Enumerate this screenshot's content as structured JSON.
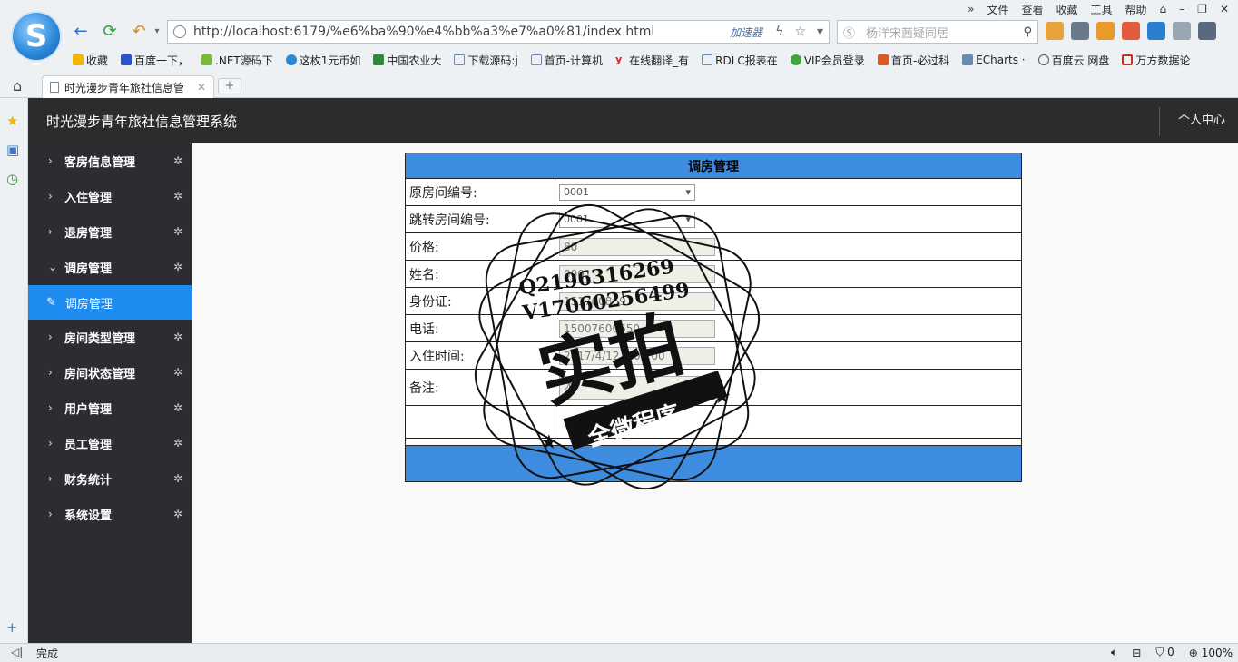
{
  "browser": {
    "menu": [
      "»",
      "文件",
      "查看",
      "收藏",
      "工具",
      "帮助"
    ],
    "url": "http://localhost:6179/%e6%ba%90%e4%bb%a3%e7%a0%81/index.html",
    "accelerator": "加速器",
    "search_placeholder": "杨洋宋茜疑同居",
    "bookmarks": [
      "收藏",
      "百度一下，",
      ".NET源码下",
      "这枚1元币如",
      "中国农业大",
      "下载源码:j",
      "首页-计算机",
      "在线翻译_有",
      "RDLC报表在",
      "VIP会员登录",
      "首页-必过科",
      "ECharts ·",
      "百度云 网盘",
      "万方数据论"
    ],
    "tab_title": "时光漫步青年旅社信息管",
    "status": "完成",
    "zoom": "100%",
    "counter": "0"
  },
  "app": {
    "title": "时光漫步青年旅社信息管理系统",
    "user_menu": "个人中心"
  },
  "sidebar": {
    "items": [
      {
        "label": "客房信息管理"
      },
      {
        "label": "入住管理"
      },
      {
        "label": "退房管理"
      },
      {
        "label": "调房管理"
      }
    ],
    "active_sub": "调房管理",
    "items_after": [
      {
        "label": "房间类型管理"
      },
      {
        "label": "房间状态管理"
      },
      {
        "label": "用户管理"
      },
      {
        "label": "员工管理"
      },
      {
        "label": "财务统计"
      },
      {
        "label": "系统设置"
      }
    ]
  },
  "form": {
    "title": "调房管理",
    "fields": {
      "orig_room_label": "原房间编号:",
      "orig_room_value": "0001",
      "target_room_label": "跳转房间编号:",
      "target_room_value": "0001",
      "price_label": "价格:",
      "price_value": "80",
      "name_label": "姓名:",
      "name_value": "0001",
      "id_label": "身份证:",
      "id_value": "1517608697",
      "phone_label": "电话:",
      "phone_value": "15007600650",
      "checkin_label": "入住时间:",
      "checkin_value": "2017/4/12 0:00:00",
      "remark_label": "备注:",
      "remark_value": "无"
    }
  },
  "watermark": {
    "line1": "Q2196316269",
    "line2": "V17060256499",
    "big": "实拍",
    "banner": "全微程序"
  },
  "colors": {
    "header_bg": "#2c2c2c",
    "sidebar_bg": "#2b2d33",
    "active_blue": "#1e8bf0",
    "table_blue": "#3e8ce0"
  }
}
